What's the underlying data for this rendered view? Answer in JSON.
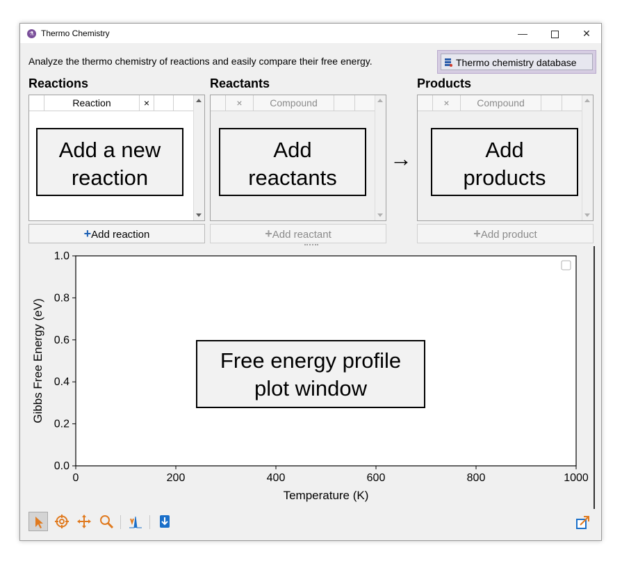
{
  "window": {
    "title": "Thermo Chemistry",
    "controls": {
      "minimize": "—",
      "maximize": "",
      "close": "✕"
    }
  },
  "header": {
    "description": "Analyze the thermo chemistry of reactions and easily compare their free energy.",
    "db_button_label": "Thermo chemistry database"
  },
  "reactions": {
    "title": "Reactions",
    "column_header": "Reaction",
    "remove_symbol": "×",
    "add_button": "Add reaction",
    "callout_line1": "Add a new",
    "callout_line2": "reaction"
  },
  "reactants": {
    "title": "Reactants",
    "remove_symbol": "×",
    "column_header": "Compound",
    "add_button": "Add reactant",
    "callout_line1": "Add",
    "callout_line2": "reactants"
  },
  "products": {
    "title": "Products",
    "remove_symbol": "×",
    "column_header": "Compound",
    "add_button": "Add product",
    "callout_line1": "Add",
    "callout_line2": "products"
  },
  "flow_arrow": "→",
  "plot_callout": {
    "line1": "Free energy profile",
    "line2": "plot window"
  },
  "chart_data": {
    "type": "line",
    "series": [],
    "xlabel": "Temperature (K)",
    "ylabel": "Gibbs Free Energy (eV)",
    "xlim": [
      0,
      1000
    ],
    "ylim": [
      0,
      1.0
    ],
    "xticks": [
      "0",
      "200",
      "400",
      "600",
      "800",
      "1000"
    ],
    "yticks": [
      "0.0",
      "0.2",
      "0.4",
      "0.6",
      "0.8",
      "1.0"
    ],
    "grid": false,
    "legend": "top-right"
  },
  "toolbar": {
    "tools": [
      "select-tool",
      "crosshair-tool",
      "pan-tool",
      "zoom-tool",
      "spectrum-tool",
      "export-tool"
    ],
    "accent_orange": "#e07a1f",
    "accent_blue": "#1a6fc9"
  },
  "colors": {
    "window_bg": "#f0f0f0",
    "db_highlight": "#d6cde2"
  }
}
